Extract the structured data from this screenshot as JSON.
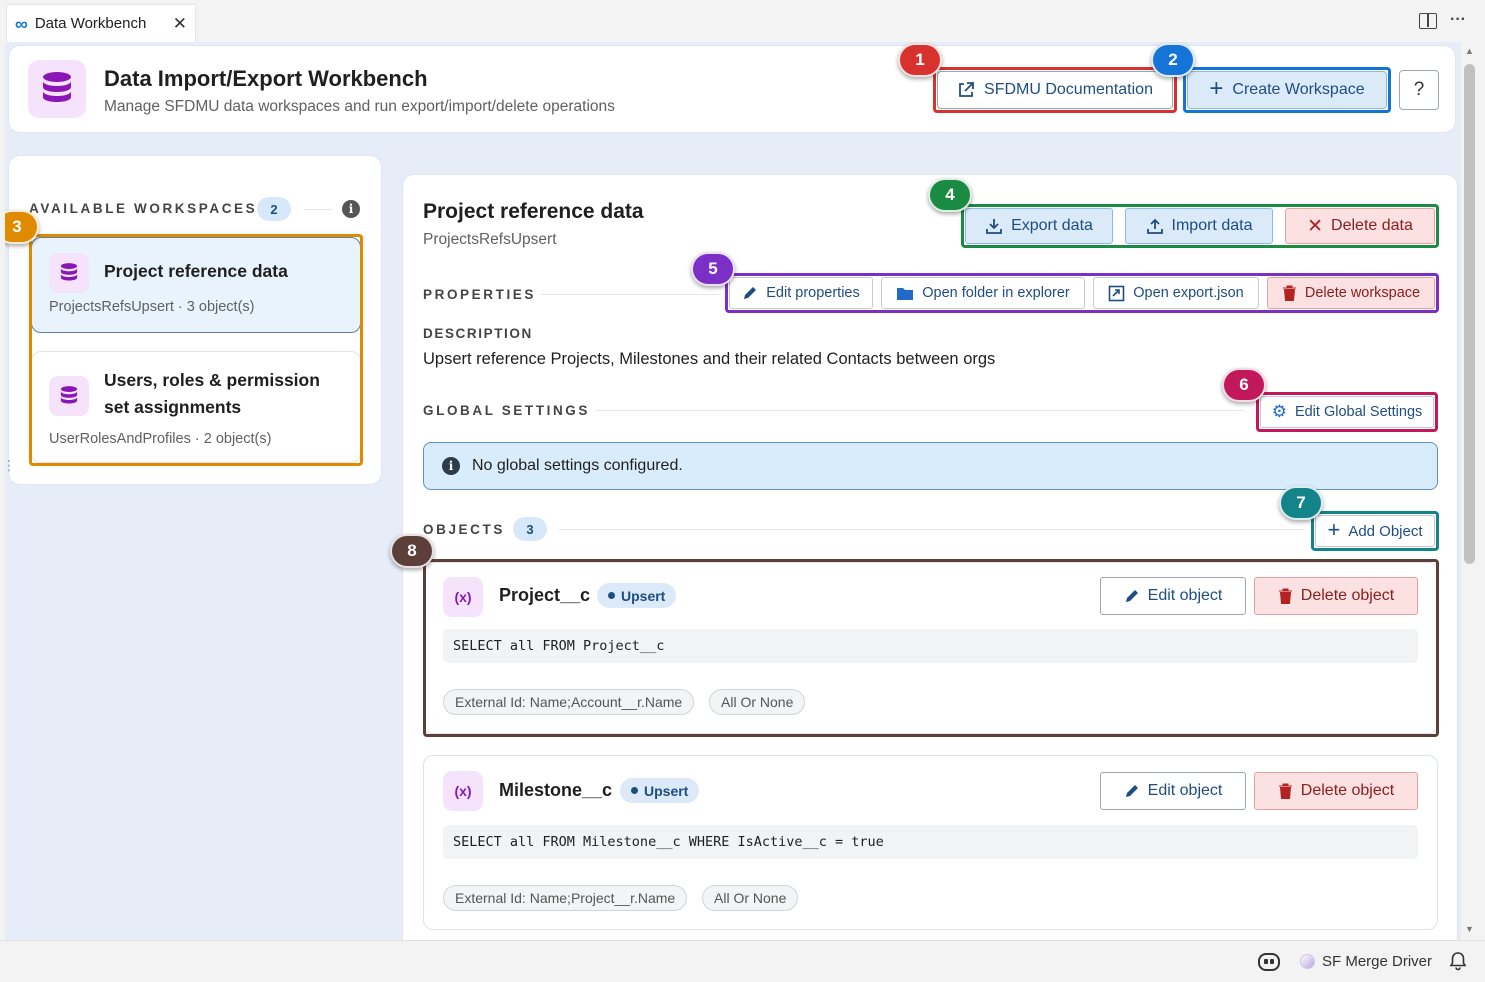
{
  "tab": {
    "title": "Data Workbench",
    "close_glyph": "✕"
  },
  "window_actions": {
    "more_glyph": "···"
  },
  "header": {
    "title": "Data Import/Export Workbench",
    "subtitle": "Manage SFDMU data workspaces and run export/import/delete operations",
    "doc_button": "SFDMU Documentation",
    "create_button": "Create Workspace",
    "help_button": "?"
  },
  "sidebar": {
    "section_label": "AVAILABLE WORKSPACES",
    "count": "2",
    "info_glyph": "i",
    "workspaces": [
      {
        "title": "Project reference data",
        "meta": "ProjectsRefsUpsert · 3 object(s)"
      },
      {
        "title": "Users, roles & permission set assignments",
        "meta": "UserRolesAndProfiles · 2 object(s)"
      }
    ]
  },
  "workspace": {
    "title": "Project reference data",
    "name": "ProjectsRefsUpsert",
    "actions": {
      "export": "Export data",
      "import": "Import data",
      "delete": "Delete data"
    },
    "properties": {
      "label": "PROPERTIES",
      "edit": "Edit properties",
      "open_folder": "Open folder in explorer",
      "open_export": "Open export.json",
      "delete_workspace": "Delete workspace"
    },
    "description_label": "DESCRIPTION",
    "description": "Upsert reference Projects, Milestones and their related Contacts between orgs",
    "global_settings": {
      "label": "GLOBAL SETTINGS",
      "edit": "Edit Global Settings",
      "empty_message": "No global settings configured.",
      "info_glyph": "i"
    },
    "objects": {
      "label": "OBJECTS",
      "count": "3",
      "add": "Add Object",
      "items": [
        {
          "name": "Project__c",
          "operation": "Upsert",
          "edit": "Edit object",
          "delete": "Delete object",
          "query": "SELECT all FROM Project__c",
          "tags": [
            "External Id: Name;Account__r.Name",
            "All Or None"
          ]
        },
        {
          "name": "Milestone__c",
          "operation": "Upsert",
          "edit": "Edit object",
          "delete": "Delete object",
          "query": "SELECT all FROM Milestone__c WHERE IsActive__c = true",
          "tags": [
            "External Id: Name;Project__r.Name",
            "All Or None"
          ]
        }
      ]
    }
  },
  "markers": [
    "1",
    "2",
    "3",
    "4",
    "5",
    "6",
    "7",
    "8"
  ],
  "marker_colors": {
    "1": "#d8322f",
    "2": "#1474d8",
    "3": "#e08a00",
    "4": "#1b8a43",
    "5": "#7b2fc7",
    "6": "#c2185b",
    "7": "#138489",
    "8": "#5d3f39"
  },
  "status_bar": {
    "extension": "SF Merge Driver"
  }
}
